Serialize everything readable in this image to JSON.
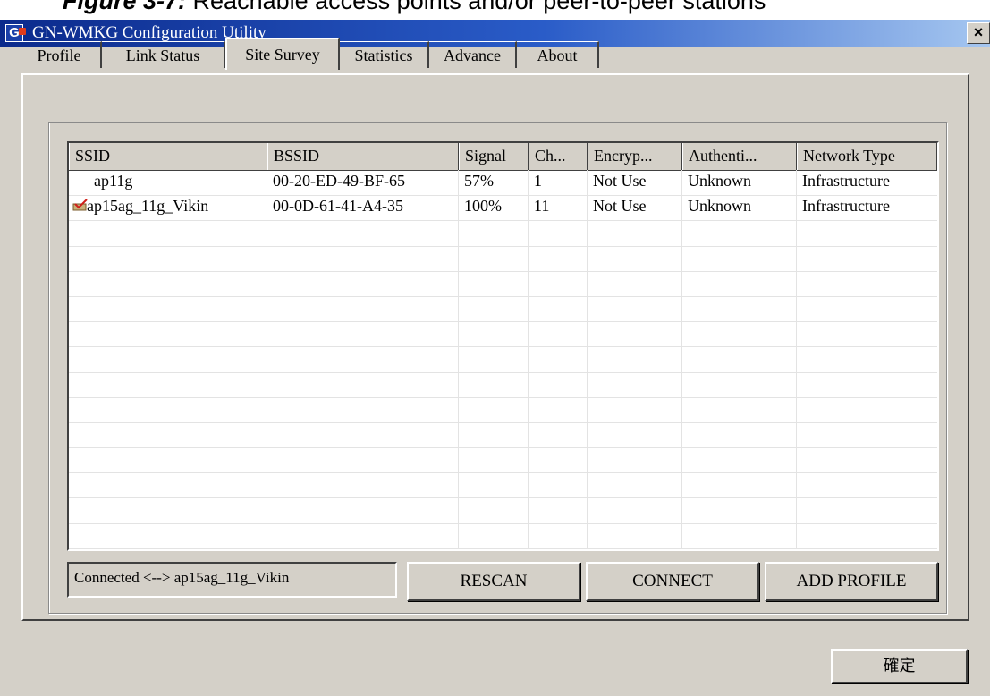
{
  "caption": {
    "figure": "Figure 3-7:",
    "text": "Reachable access points and/or peer-to-peer stations"
  },
  "window": {
    "title": "GN-WMKG Configuration Utility",
    "close_label": "×"
  },
  "tabs": [
    {
      "label": "Profile"
    },
    {
      "label": "Link Status"
    },
    {
      "label": "Site Survey"
    },
    {
      "label": "Statistics"
    },
    {
      "label": "Advance"
    },
    {
      "label": "About"
    }
  ],
  "active_tab": "Site Survey",
  "site_survey": {
    "columns": [
      "SSID",
      "BSSID",
      "Signal",
      "Ch...",
      "Encryp...",
      "Authenti...",
      "Network Type"
    ],
    "rows": [
      {
        "ssid": "ap11g",
        "bssid": "00-20-ED-49-BF-65",
        "signal": "57%",
        "channel": "1",
        "encryption": "Not Use",
        "authentication": "Unknown",
        "network_type": "Infrastructure",
        "connected": false
      },
      {
        "ssid": "ap15ag_11g_Vikin",
        "bssid": "00-0D-61-41-A4-35",
        "signal": "100%",
        "channel": "11",
        "encryption": "Not Use",
        "authentication": "Unknown",
        "network_type": "Infrastructure",
        "connected": true
      }
    ],
    "status": "Connected <--> ap15ag_11g_Vikin",
    "buttons": {
      "rescan": "RESCAN",
      "connect": "CONNECT",
      "add_profile": "ADD PROFILE"
    }
  },
  "dialog": {
    "ok_label": "確定"
  },
  "colors": {
    "titlebar_start": "#0b2a8c",
    "titlebar_end": "#a6c7f0",
    "face": "#d4d0c8"
  }
}
